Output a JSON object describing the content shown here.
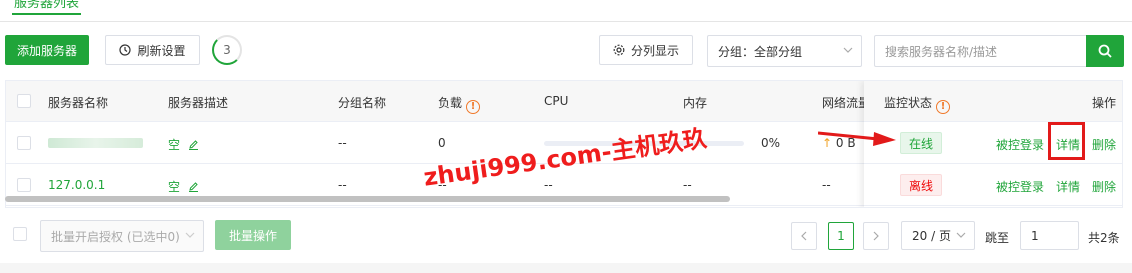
{
  "top_tab": {
    "label": "服务器列表"
  },
  "toolbar": {
    "add_server": "添加服务器",
    "refresh_settings": "刷新设置",
    "refresh_count": "3",
    "column_display": "分列显示",
    "group_select": "分组：全部分组",
    "search_placeholder": "搜索服务器名称/描述"
  },
  "table": {
    "headers": {
      "name": "服务器名称",
      "desc": "服务器描述",
      "group": "分组名称",
      "load": "负载",
      "cpu": "CPU",
      "memory": "内存",
      "network": "网络流量",
      "monitor": "监控状态",
      "actions": "操作"
    },
    "rows": [
      {
        "name": "",
        "desc": "空",
        "group": "--",
        "load": "0",
        "cpu": "",
        "memory": "0%",
        "network": "0 B",
        "status": "在线",
        "actions": {
          "remote": "被控登录",
          "detail": "详情",
          "delete": "删除"
        }
      },
      {
        "name": "127.0.0.1",
        "desc": "空",
        "group": "--",
        "load": "--",
        "cpu": "--",
        "memory": "--",
        "network": "--",
        "status": "离线",
        "actions": {
          "remote": "被控登录",
          "detail": "详情",
          "delete": "删除"
        }
      }
    ]
  },
  "footer": {
    "batch_auth": "批量开启授权 (已选中0)",
    "batch_op": "批量操作",
    "page": "1",
    "page_size": "20 / 页",
    "goto_label": "跳至",
    "goto_value": "1",
    "total": "共2条"
  },
  "watermark": "zhuji999.com-主机玖玖",
  "colors": {
    "brand": "#20a53a",
    "danger": "#ef0808",
    "warn": "#f0792a",
    "annotation": "#e21a1a"
  }
}
